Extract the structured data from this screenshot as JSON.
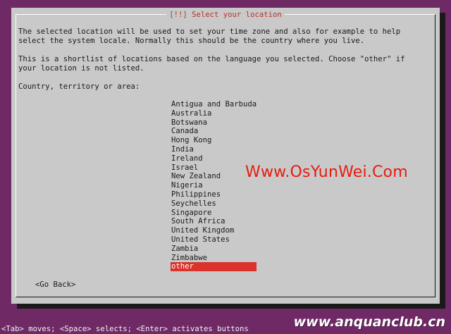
{
  "dialog": {
    "title": "[!!] Select your location",
    "paragraph1": "The selected location will be used to set your time zone and also for example to help\nselect the system locale. Normally this should be the country where you live.",
    "paragraph2": "This is a shortlist of locations based on the language you selected. Choose \"other\" if\nyour location is not listed.",
    "prompt": "Country, territory or area:",
    "countries": [
      "Antigua and Barbuda",
      "Australia",
      "Botswana",
      "Canada",
      "Hong Kong",
      "India",
      "Ireland",
      "Israel",
      "New Zealand",
      "Nigeria",
      "Philippines",
      "Seychelles",
      "Singapore",
      "South Africa",
      "United Kingdom",
      "United States",
      "Zambia",
      "Zimbabwe",
      "other"
    ],
    "selected_country": "other",
    "go_back_label": "<Go Back>"
  },
  "statusbar": {
    "text": "<Tab> moves; <Space> selects; <Enter> activates buttons"
  },
  "watermarks": {
    "center": "Www.OsYunWei.Com",
    "bottom_right": "www.anquanclub.cn"
  },
  "colors": {
    "background": "#6f2a66",
    "dialog": "#c9c9c9",
    "selection": "#d9332b",
    "title_text": "#b5342a"
  }
}
